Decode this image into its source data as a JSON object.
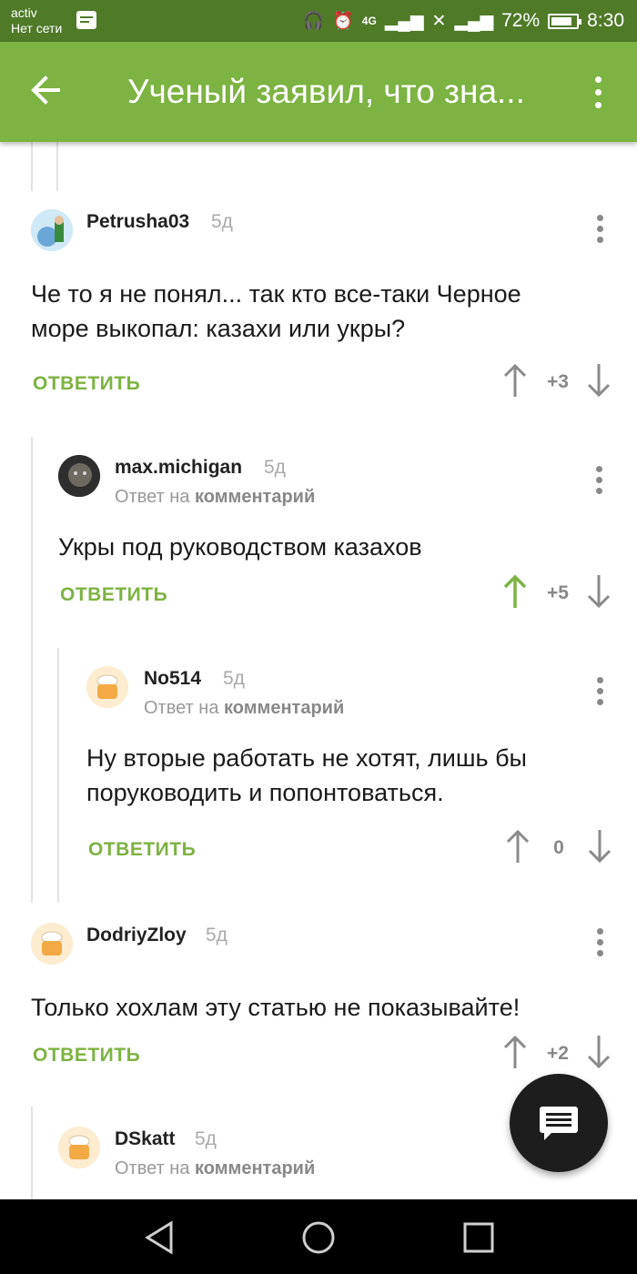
{
  "status": {
    "carrier": "activ",
    "network": "Нет сети",
    "battery": "72%",
    "time": "8:30",
    "network_type": "4G"
  },
  "appbar": {
    "title": "Ученый заявил, что зна...",
    "bg_color": "#7cb342"
  },
  "comments": [
    {
      "author": "Petrusha03",
      "time": "5д",
      "text_lines": [
        "Че то я не понял... так кто все-таки Черное",
        "море выкопал: казахи или укры?"
      ],
      "reply_label": "ОТВЕТИТЬ",
      "score": "+3",
      "upvoted": false
    },
    {
      "author": "max.michigan",
      "time": "5д",
      "reply_prefix": "Ответ на",
      "reply_link": "комментарий",
      "text_lines": [
        "Укры под руководством казахов"
      ],
      "reply_label": "ОТВЕТИТЬ",
      "score": "+5",
      "upvoted": true
    },
    {
      "author": "No514",
      "time": "5д",
      "reply_prefix": "Ответ на",
      "reply_link": "комментарий",
      "text_lines": [
        "Ну вторые работать не хотят, лишь бы",
        "поруководить и попонтоваться."
      ],
      "reply_label": "ОТВЕТИТЬ",
      "score": "0",
      "upvoted": false
    },
    {
      "author": "DodriyZloy",
      "time": "5д",
      "text_lines": [
        "Только хохлам эту статью не показывайте!"
      ],
      "reply_label": "ОТВЕТИТЬ",
      "score": "+2",
      "upvoted": false
    },
    {
      "author": "DSkatt",
      "time": "5д",
      "reply_prefix": "Ответ на",
      "reply_link": "комментарий"
    }
  ],
  "colors": {
    "accent_green": "#7cb342",
    "status_green": "#4f7a28",
    "fab": "#1d1d1d"
  },
  "icons": {
    "back": "arrow-left-icon",
    "menu": "more-vert-icon",
    "fab": "comment-icon",
    "up": "arrow-up-icon",
    "down": "arrow-down-icon"
  }
}
